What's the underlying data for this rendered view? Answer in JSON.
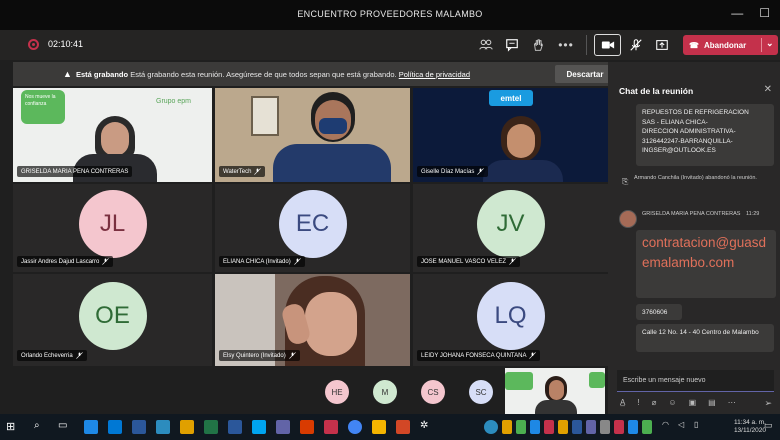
{
  "window": {
    "title": "ENCUENTRO PROVEEDORES MALAMBO"
  },
  "call": {
    "timer": "02:10:41",
    "leave_label": "Abandonar"
  },
  "banner": {
    "bold": "Está grabando",
    "text": "Está grabando esta reunión. Asegúrese de que todos sepan que está grabando.",
    "link": "Política de privacidad",
    "dismiss_label": "Descartar"
  },
  "tiles": [
    {
      "name": "GRISELDA MARIA PENA CONTRERAS",
      "muted": false,
      "brand": "Grupo epm",
      "sign": "Nos mueve la confianza"
    },
    {
      "name": "WaterTech",
      "muted": true
    },
    {
      "name": "Giselle Díaz Macías",
      "muted": true,
      "brand": "emtel"
    },
    {
      "name": "Jassir Andres Dajud Lascarro",
      "initials": "JL",
      "muted": true
    },
    {
      "name": "ELIANA CHICA (Invitado)",
      "initials": "EC",
      "muted": true
    },
    {
      "name": "JOSE MANUEL VASCO VELEZ",
      "initials": "JV",
      "muted": true
    },
    {
      "name": "Orlando Echeverria",
      "initials": "OE",
      "muted": true
    },
    {
      "name": "Elsy Quintero (Invitado)",
      "muted": true
    },
    {
      "name": "LEIDY JOHANA FONSECA QUINTANA",
      "initials": "LQ",
      "muted": true
    }
  ],
  "strip": {
    "avatars": [
      {
        "initials": "HE",
        "color": "#f4c6ce"
      },
      {
        "initials": "M",
        "color": "#cfe8d0"
      },
      {
        "initials": "CS",
        "color": "#f4c6ce"
      },
      {
        "initials": "SC",
        "color": "#d7def7"
      }
    ]
  },
  "chat": {
    "title": "Chat de la reunión",
    "first_message": [
      "REPUESTOS DE REFRIGERACION",
      "SAS - ELIANA CHICA-",
      "DIRECCION ADMINISTRATIVA-",
      "3126442247-BARRANQUILLA-",
      "INGSER@OUTLOOK.ES"
    ],
    "system_message": "Armando Canchila (Invitado) abandonó la reunión.",
    "sender": "GRISELDA MARIA PENA CONTRERAS",
    "sender_time": "11:29",
    "email_text": "contratacion@guasdemalambo.com",
    "phone": "3760606",
    "address": "Calle 12 No. 14 - 40 Centro de Malambo",
    "compose_placeholder": "Escribe un mensaje nuevo"
  },
  "taskbar": {
    "time": "11:34 a. m.",
    "date": "13/11/2020"
  },
  "colors": {
    "accent": "#6264a7",
    "leave": "#c4314b",
    "link_text": "#e0705a"
  }
}
